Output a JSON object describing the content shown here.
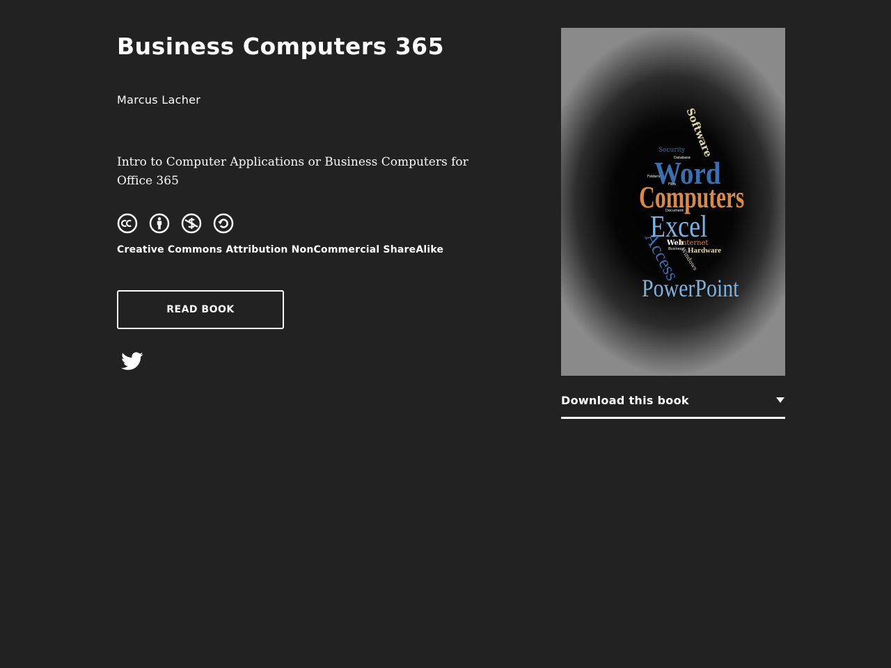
{
  "book": {
    "title": "Business Computers 365",
    "author": "Marcus Lacher",
    "description": "Intro to Computer Applications or Business Computers for Office 365",
    "license_icons": [
      "cc-icon",
      "attribution-icon",
      "noncommercial-icon",
      "sharealike-icon"
    ],
    "license_label": "Creative Commons Attribution NonCommercial ShareAlike",
    "read_button": "READ BOOK",
    "share_icon": "twitter-icon"
  },
  "cover": {
    "words": [
      "Software",
      "Security",
      "Database",
      "Word",
      "Folders",
      "Files",
      "Computers",
      "Document",
      "Excel",
      "Web",
      "Internet",
      "Business",
      "Hardware",
      "Access",
      "Windows",
      "PowerPoint"
    ],
    "colors": {
      "blue": "#3a6fb0",
      "orange": "#d9894a",
      "light_blue": "#7fb1de",
      "cream": "#e3d9a4"
    }
  },
  "download": {
    "label": "Download this book"
  }
}
